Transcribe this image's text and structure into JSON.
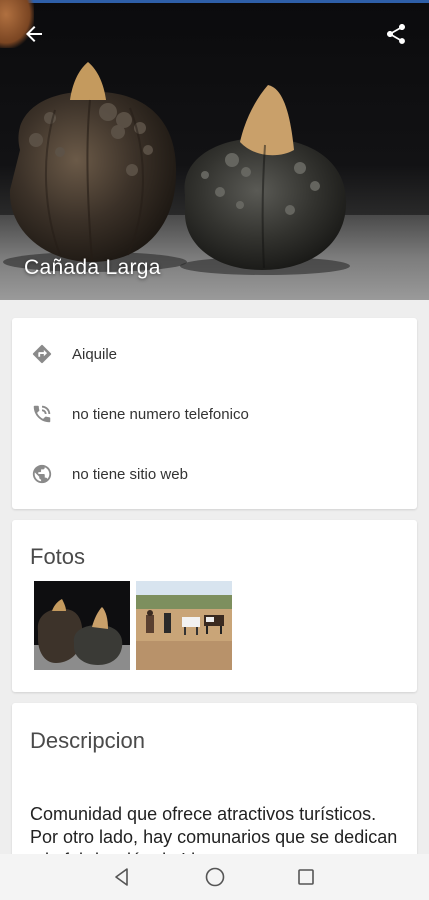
{
  "hero": {
    "title": "Cañada Larga",
    "back_icon": "arrow-back-icon",
    "share_icon": "share-icon"
  },
  "info": {
    "items": [
      {
        "icon": "directions-icon",
        "label": "Aiquile"
      },
      {
        "icon": "phone-icon",
        "label": "no tiene numero telefonico"
      },
      {
        "icon": "globe-icon",
        "label": "no tiene sitio web"
      }
    ]
  },
  "photos": {
    "title": "Fotos"
  },
  "description": {
    "title": "Descripcion",
    "text": "Comunidad que ofrece atractivos turísticos. Por otro lado, hay comunarios que se dedican a la fabricación de Ll..."
  },
  "navbar": {
    "back_icon": "nav-back-icon",
    "home_icon": "nav-home-icon",
    "recents_icon": "nav-recents-icon"
  },
  "colors": {
    "accent": "#2e5fa8",
    "card": "#ffffff",
    "background": "#eeeeee",
    "icon_grey": "#8a8a8a"
  }
}
